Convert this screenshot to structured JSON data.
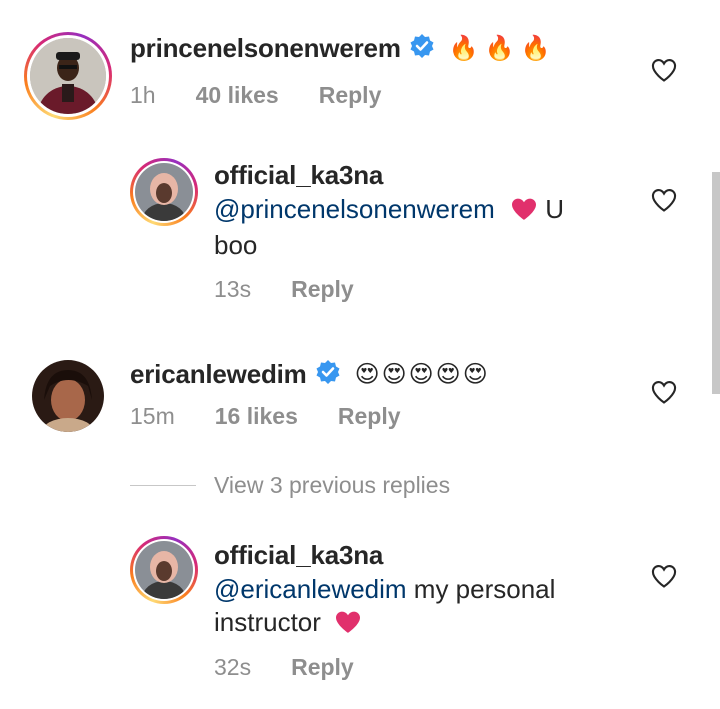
{
  "comments": [
    {
      "username": "princenelsonenwerem",
      "verified": true,
      "text_emoji": "🔥🔥🔥",
      "time": "1h",
      "likes": "40 likes",
      "reply": "Reply"
    },
    {
      "username": "official_ka3na",
      "mention": "@princenelsonenwerem",
      "text_after": " U",
      "text_line2": "boo",
      "time": "13s",
      "reply": "Reply"
    },
    {
      "username": "ericanlewedim",
      "verified": true,
      "text_emoji": "😍😍😍😍😍",
      "time": "15m",
      "likes": "16 likes",
      "reply": "Reply"
    },
    {
      "view_replies": "View 3 previous replies"
    },
    {
      "username": "official_ka3na",
      "mention": "@ericanlewedim",
      "text_after": " my personal",
      "text_line2": "instructor",
      "time": "32s",
      "reply": "Reply"
    }
  ],
  "colors": {
    "mention": "#00376b",
    "meta": "#8e8e8e",
    "heart": "#e1306c",
    "verified": "#3897f0"
  }
}
